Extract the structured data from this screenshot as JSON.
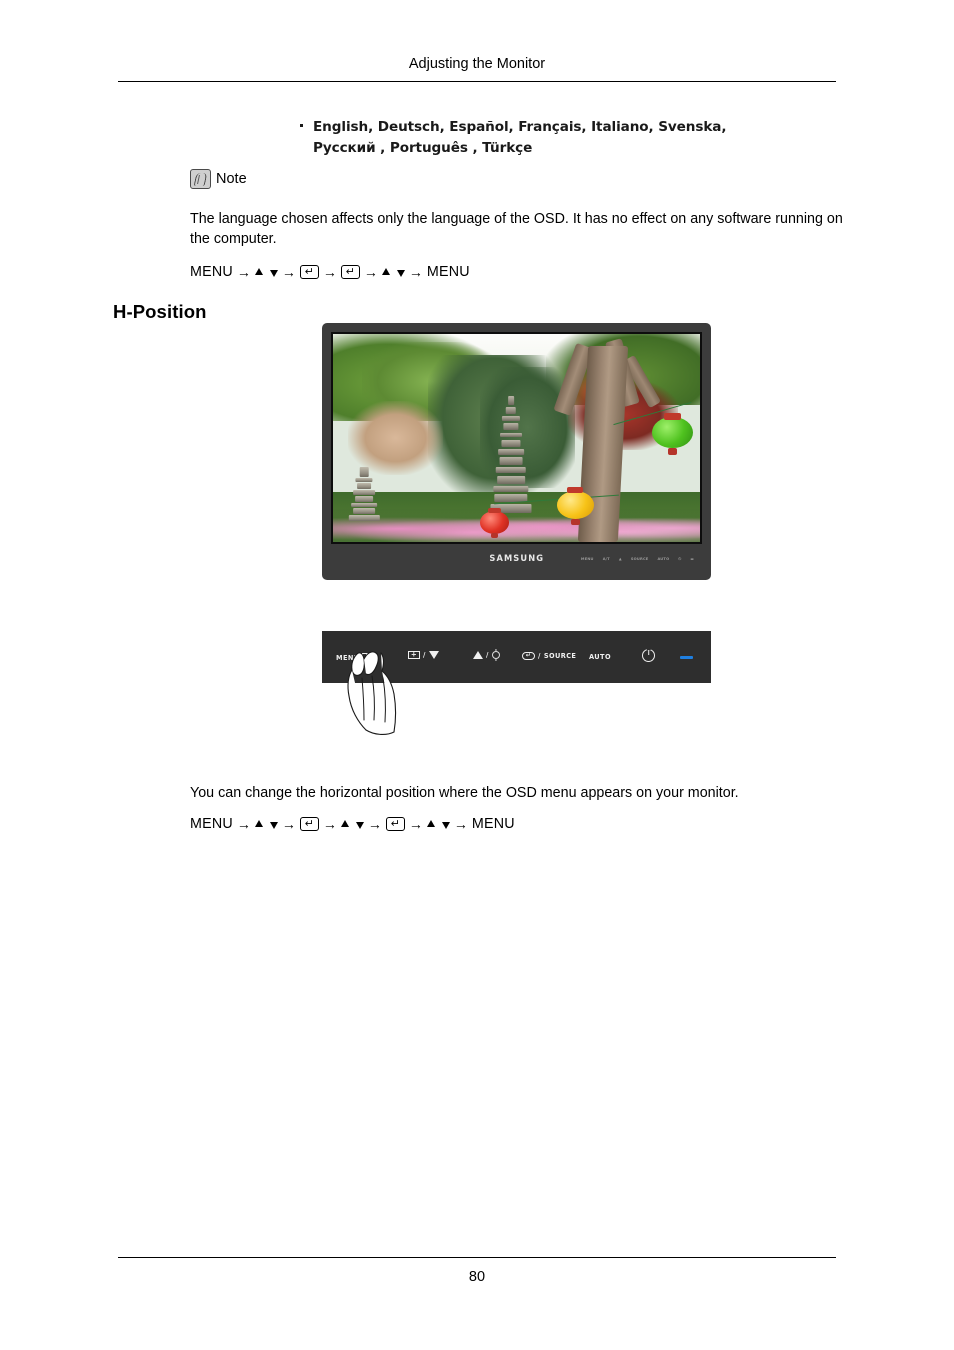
{
  "header": {
    "title": "Adjusting the Monitor"
  },
  "footer": {
    "page_number": "80"
  },
  "languages": {
    "line1": "English, Deutsch, Español, Français,  Italiano, Svenska,",
    "line2": "Русский , Português , Türkçe"
  },
  "note": {
    "label": "Note",
    "icon": "note-pencil-icon",
    "text": "The language chosen affects only the language of the OSD. It has no effect on any software running on the computer."
  },
  "menu_path_1": {
    "start": "MENU",
    "end": "MENU",
    "arrow": "→",
    "enter_glyph": "↵",
    "triangle_up": "▲",
    "triangle_down": "▼"
  },
  "menu_path_2": {
    "start": "MENU",
    "end": "MENU",
    "arrow": "→",
    "enter_glyph": "↵",
    "triangle_up": "▲",
    "triangle_down": "▼"
  },
  "section": {
    "heading": "H-Position",
    "description": "You can change the horizontal position where the OSD menu appears on your monitor."
  },
  "monitor": {
    "brand_logo": "SAMSUNG",
    "bezel_controls": [
      "MENU",
      "A/T",
      "▲",
      "SOURCE",
      "AUTO",
      "⏻",
      "▬"
    ],
    "screen_image_alt": "garden scene with stone pagodas, trees and paper lanterns"
  },
  "control_panel": {
    "menu_label": "MENU",
    "menu_icon": "menu-grid-icon",
    "brightness_icon": "plus-box-icon",
    "down_icon": "triangle-down-icon",
    "up_icon": "triangle-up-icon",
    "sun_icon": "brightness-sun-icon",
    "source_icon": "enter-box-icon",
    "source_label": "SOURCE",
    "auto_label": "AUTO",
    "power_icon": "power-icon",
    "led_icon": "led-indicator",
    "separator": "/"
  },
  "colors": {
    "bezel": "#3c3c3c",
    "panel": "#2e2e2e",
    "led_blue": "#1f7fe0",
    "text": "#000000"
  }
}
